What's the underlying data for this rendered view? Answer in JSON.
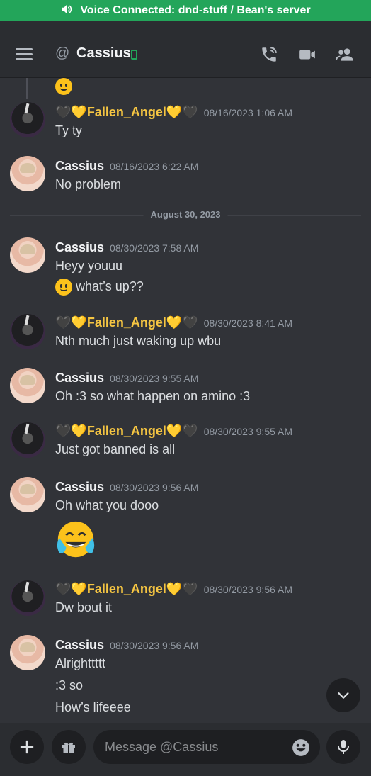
{
  "voice_bar": {
    "text": "Voice Connected: dnd-stuff / Bean's server"
  },
  "header": {
    "at_symbol": "@",
    "title": "Cassius"
  },
  "date_divider": "August 30, 2023",
  "messages": [
    {
      "author": "Fallen_Angel",
      "time": "08/16/2023 1:06 AM",
      "lines": [
        "Ty ty"
      ]
    },
    {
      "author": "Cassius",
      "time": "08/16/2023 6:22 AM",
      "lines": [
        "No problem"
      ]
    },
    {
      "author": "Cassius",
      "time": "08/30/2023 7:58 AM",
      "lines": [
        "Heyy youuu",
        "what’s up??"
      ]
    },
    {
      "author": "Fallen_Angel",
      "time": "08/30/2023 8:41 AM",
      "lines": [
        "Nth much just waking up wbu"
      ]
    },
    {
      "author": "Cassius",
      "time": "08/30/2023 9:55 AM",
      "lines": [
        "Oh :3 so what happen on amino :3"
      ]
    },
    {
      "author": "Fallen_Angel",
      "time": "08/30/2023 9:55 AM",
      "lines": [
        "Just got banned is all"
      ]
    },
    {
      "author": "Cassius",
      "time": "08/30/2023 9:56 AM",
      "lines": [
        "Oh what you dooo"
      ]
    },
    {
      "author": "Fallen_Angel",
      "time": "08/30/2023 9:56 AM",
      "lines": [
        "Dw bout it"
      ]
    },
    {
      "author": "Cassius",
      "time": "08/30/2023 9:56 AM",
      "lines": [
        "Alrighttttt",
        ":3 so",
        "How’s lifeeee"
      ]
    }
  ],
  "hearts": {
    "left": "🖤💛",
    "right": "💛🖤"
  },
  "composer": {
    "placeholder": "Message @Cassius"
  },
  "colors": {
    "voice_green": "#23a55a",
    "background": "#313338",
    "header": "#2b2d31"
  }
}
